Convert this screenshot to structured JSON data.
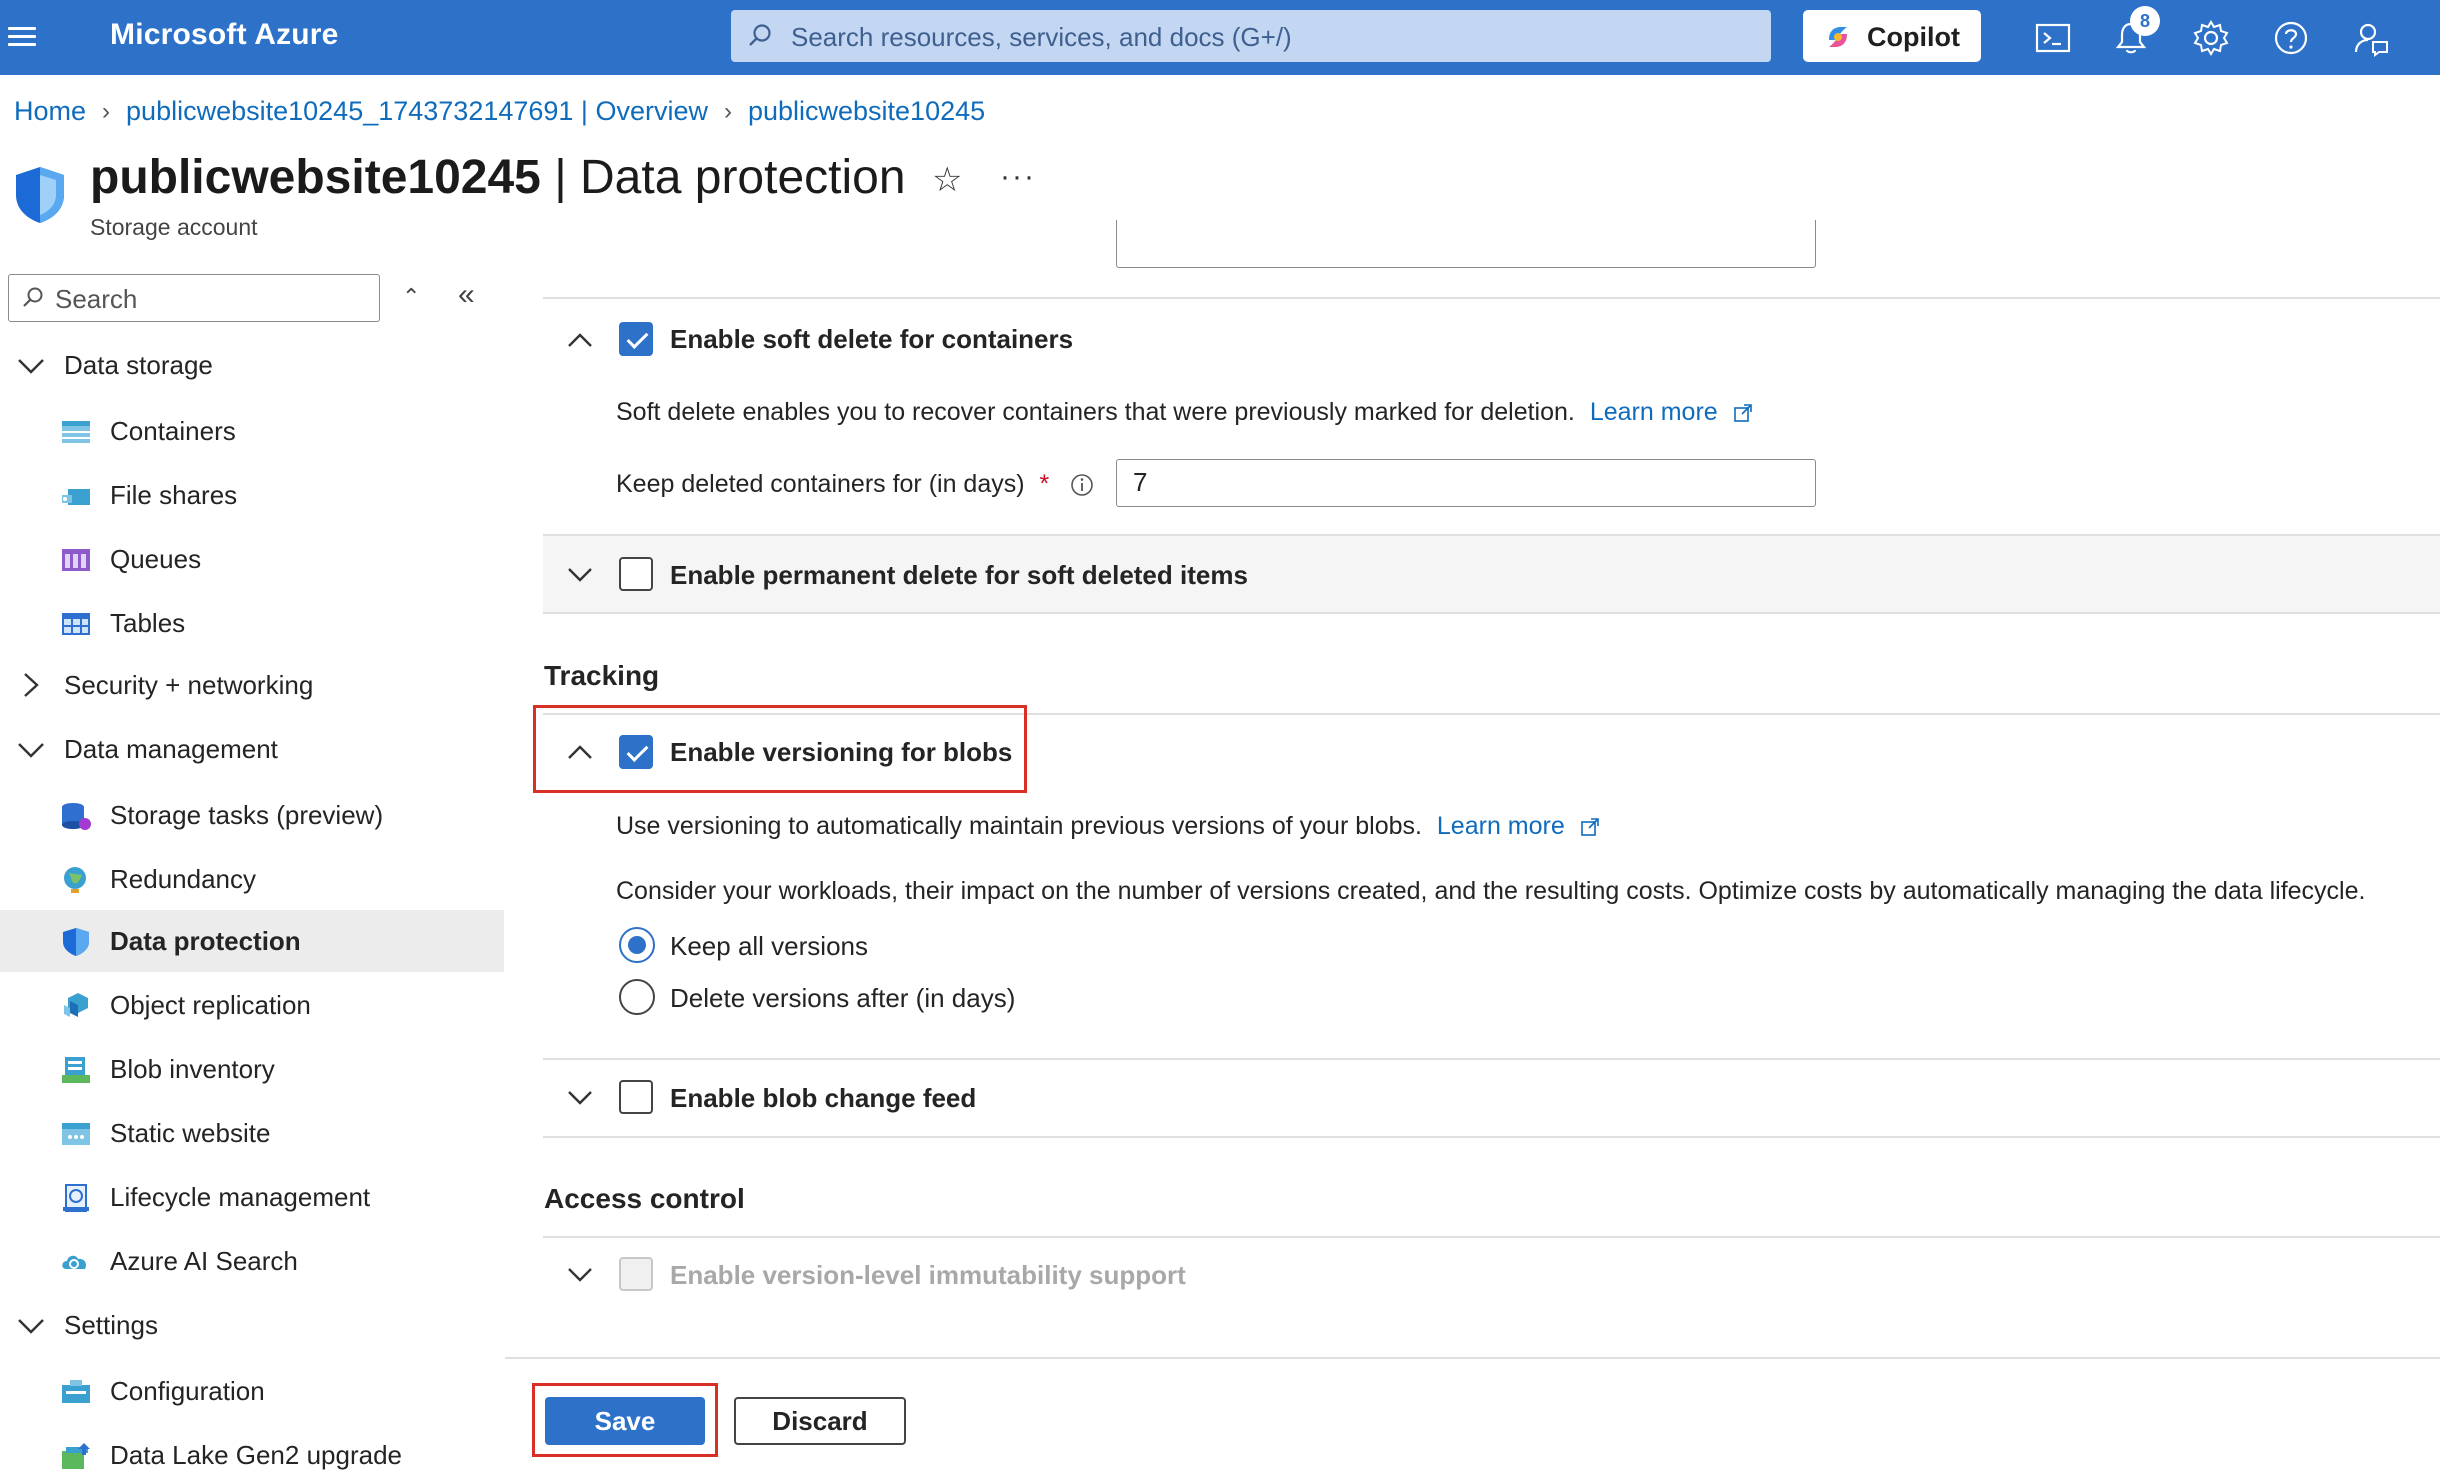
{
  "topbar": {
    "brand": "Microsoft Azure",
    "search_placeholder": "Search resources, services, and docs (G+/)",
    "copilot_label": "Copilot",
    "notification_count": "8"
  },
  "breadcrumb": [
    "Home",
    "publicwebsite10245_1743732147691 | Overview",
    "publicwebsite10245"
  ],
  "header": {
    "resource_name": "publicwebsite10245",
    "page_name": " | Data protection",
    "subtitle": "Storage account"
  },
  "sidebar": {
    "search_placeholder": "Search",
    "groups": {
      "data_storage": "Data storage",
      "security_networking": "Security + networking",
      "data_management": "Data management",
      "settings": "Settings"
    },
    "items": {
      "containers": "Containers",
      "file_shares": "File shares",
      "queues": "Queues",
      "tables": "Tables",
      "storage_tasks": "Storage tasks (preview)",
      "redundancy": "Redundancy",
      "data_protection": "Data protection",
      "object_replication": "Object replication",
      "blob_inventory": "Blob inventory",
      "static_website": "Static website",
      "lifecycle_management": "Lifecycle management",
      "azure_ai_search": "Azure AI Search",
      "configuration": "Configuration",
      "data_lake_upgrade": "Data Lake Gen2 upgrade"
    }
  },
  "main": {
    "soft_delete_containers": {
      "label": "Enable soft delete for containers",
      "checked": true,
      "description": "Soft delete enables you to recover containers that were previously marked for deletion.",
      "learn_more": "Learn more",
      "keep_label": "Keep deleted containers for (in days)",
      "required_mark": "*",
      "keep_value": "7"
    },
    "permanent_delete": {
      "label": "Enable permanent delete for soft deleted items",
      "checked": false
    },
    "tracking_heading": "Tracking",
    "versioning": {
      "label": "Enable versioning for blobs",
      "checked": true,
      "description": "Use versioning to automatically maintain previous versions of your blobs.",
      "learn_more": "Learn more",
      "consider": "Consider your workloads, their impact on the number of versions created, and the resulting costs. Optimize costs by automatically managing the data lifecycle.",
      "option_keep_all": "Keep all versions",
      "option_delete_after": "Delete versions after (in days)"
    },
    "change_feed": {
      "label": "Enable blob change feed",
      "checked": false
    },
    "access_control_heading": "Access control",
    "immutability": {
      "label": "Enable version-level immutability support",
      "checked": false,
      "disabled": true
    }
  },
  "footer": {
    "save_label": "Save",
    "discard_label": "Discard"
  },
  "colors": {
    "accent": "#2d71c9",
    "link": "#0f6cbd",
    "highlight": "#d93025"
  }
}
